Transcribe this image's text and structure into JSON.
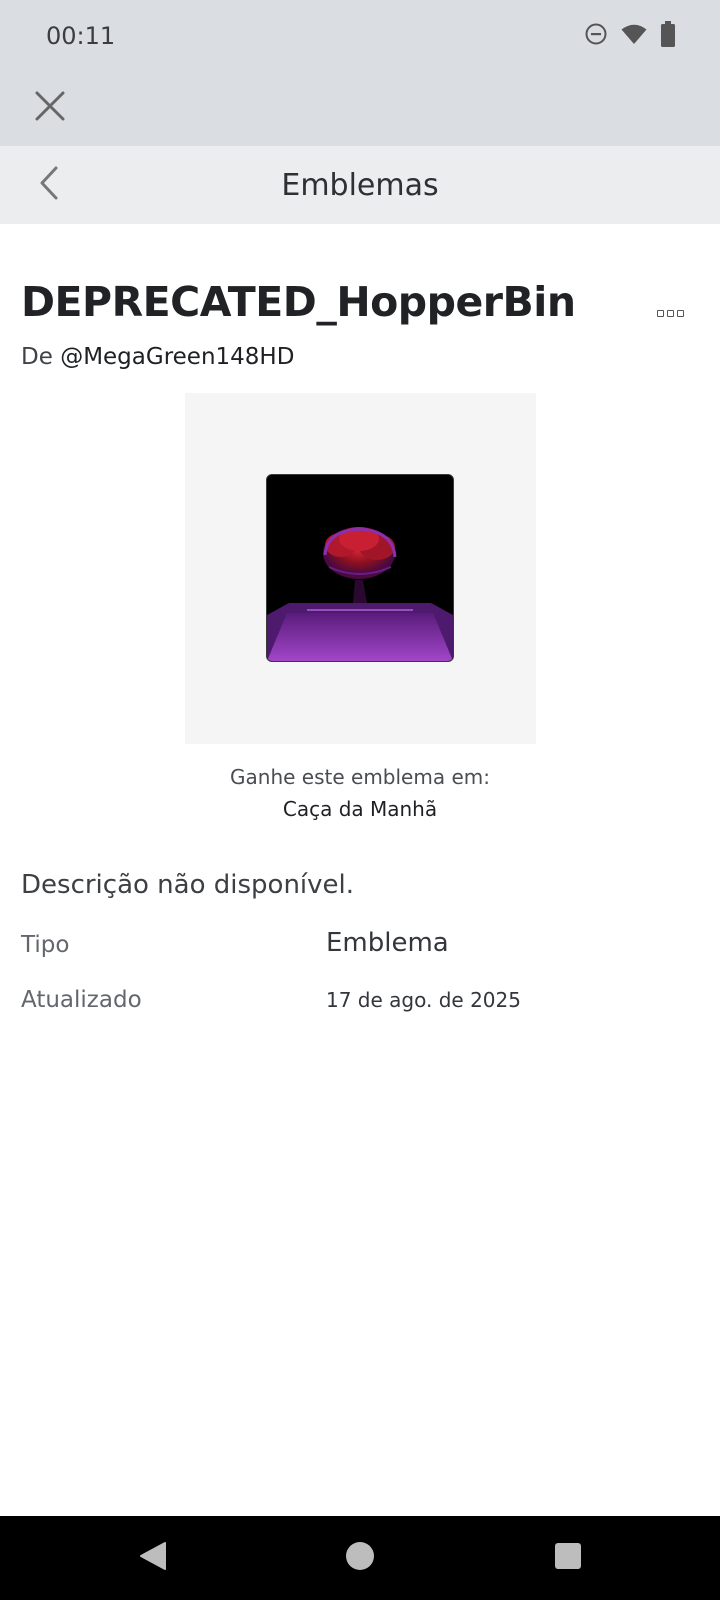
{
  "status_bar": {
    "time": "00:11",
    "icons": [
      "do-not-disturb-icon",
      "wifi-icon",
      "battery-icon"
    ]
  },
  "toolbar": {
    "close_icon": "close-icon"
  },
  "header": {
    "title": "Emblemas",
    "back_icon": "chevron-left-icon"
  },
  "badge": {
    "name": "DEPRECATED_HopperBin",
    "creator_prefix": "De",
    "creator": "@MegaGreen148HD",
    "earn_label": "Ganhe este emblema em:",
    "experience": "Caça da Manhã",
    "description": "Descrição não disponível."
  },
  "details": {
    "type_label": "Tipo",
    "type_value": "Emblema",
    "updated_label": "Atualizado",
    "updated_value": "17 de ago. de 2025"
  },
  "nav": {
    "back_icon": "nav-back-icon",
    "home_icon": "nav-home-icon",
    "recents_icon": "nav-recents-icon"
  },
  "colors": {
    "status_bar_bg": "#dadde1",
    "header_bg": "#ebedef",
    "text_primary": "#1e2024",
    "badge_purple": "#8a2fb0",
    "badge_red": "#c0182a"
  }
}
